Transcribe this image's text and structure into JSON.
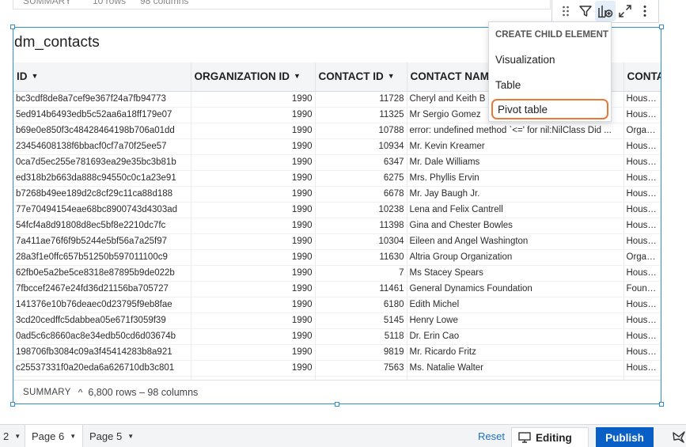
{
  "top_summary": {
    "label": "SUMMARY",
    "rows": "10 rows",
    "cols": "98 columns"
  },
  "element": {
    "title": "dm_contacts",
    "columns": [
      "ID",
      "ORGANIZATION ID",
      "CONTACT ID",
      "CONTACT NAM",
      "CONTA"
    ],
    "rows": [
      [
        "bc3cdf8de8a7cef9e367f24a7fb94773",
        "1990",
        "11728",
        "Cheryl and Keith B",
        "Househo"
      ],
      [
        "5ed914b6493edb5c52aa6a18ff179e07",
        "1990",
        "11325",
        "Mr Sergio Gomez",
        "Househo"
      ],
      [
        "b69e0e850f3c48428464198b706a01dd",
        "1990",
        "10788",
        "error: undefined method `<=' for nil:NilClass Did ...",
        "Organiza"
      ],
      [
        "23454608138f6bbacf0cf7a70f25ee57",
        "1990",
        "10934",
        "Mr.  Kevin Kreamer",
        "Househo"
      ],
      [
        "0ca7d5ec255e781693ea29e35bc3b81b",
        "1990",
        "6347",
        "Mr. Dale Williams",
        "Househo"
      ],
      [
        "ed318b2b663da888c94550c0c1a23e91",
        "1990",
        "6275",
        "Mrs. Phyllis Ervin",
        "Househo"
      ],
      [
        "b7268b49ee189d2c8cf29c11ca88d188",
        "1990",
        "6678",
        "Mr. Jay Baugh Jr.",
        "Househo"
      ],
      [
        "77e70494154eae68bc8900743d4303ad",
        "1990",
        "10238",
        "Lena and Felix Cantrell",
        "Househo"
      ],
      [
        "54fcf4a8d91808d8ec5bf8e2210dc7fc",
        "1990",
        "11398",
        "Gina and Chester Bowles",
        "Househo"
      ],
      [
        "7a411ae76f6f9b5244e5bf56a7a25f97",
        "1990",
        "10304",
        "Eileen and Angel Washington",
        "Househo"
      ],
      [
        "28a3f1e0ffc657b51250b597011100c9",
        "1990",
        "11630",
        "Altria Group Organization",
        "Organiza"
      ],
      [
        "62fb0e5a2be5ce8318e87895b9de022b",
        "1990",
        "7",
        "Ms Stacey Spears",
        "Househo"
      ],
      [
        "7fbccef2467e24fd36d21156ba705727",
        "1990",
        "11461",
        "General Dynamics Foundation",
        "Foundat"
      ],
      [
        "141376e10b76deaec0d23795f9eb8fae",
        "1990",
        "6180",
        "Edith Michel",
        "Househo"
      ],
      [
        "3cd20cedffc5dabbea05e671f3059f39",
        "1990",
        "5145",
        "Henry Lowe",
        "Househo"
      ],
      [
        "0ad5c6c8660ac8e34edb50cd6d03674b",
        "1990",
        "5118",
        "Dr. Erin Cao",
        "Househo"
      ],
      [
        "198706fb3084c09a3f45414283b8a921",
        "1990",
        "9819",
        "Mr. Ricardo Fritz",
        "Househo"
      ],
      [
        "c25537331f0a20eda6a626710db3c801",
        "1990",
        "7563",
        "Ms. Natalie Walter",
        "Househo"
      ]
    ],
    "summary": {
      "label": "SUMMARY",
      "text": "6,800 rows – 98 columns"
    }
  },
  "menu": {
    "header": "CREATE CHILD ELEMENT",
    "items": [
      "Visualization",
      "Table",
      "Pivot table"
    ]
  },
  "bottom_bar": {
    "tabs": [
      "2",
      "Page 6",
      "Page 5"
    ],
    "reset": "Reset",
    "mode": "Editing",
    "publish": "Publish"
  },
  "colors": {
    "accent": "#2f8fd6",
    "publish": "#0a5fc6",
    "highlight": "#e77a36"
  },
  "icons": [
    "drag-icon",
    "filter-icon",
    "add-chart-icon",
    "expand-icon",
    "more-icon",
    "monitor-icon",
    "bird-icon"
  ]
}
